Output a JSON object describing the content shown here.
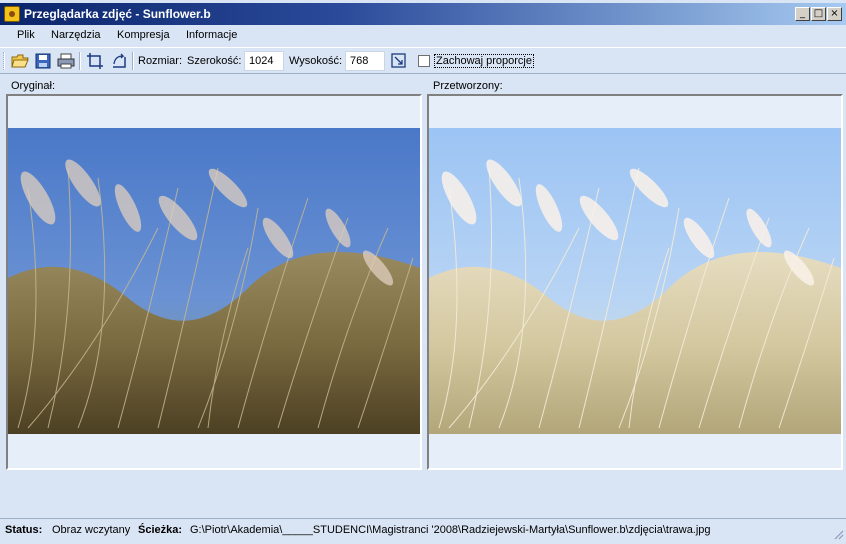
{
  "window": {
    "title": "Przeglądarka zdjęć - Sunflower.b",
    "controls": {
      "minimize": "_",
      "maximize": "□",
      "close": "×"
    }
  },
  "menu": [
    "Plik",
    "Narzędzia",
    "Kompresja",
    "Informacje"
  ],
  "toolbar": {
    "buttons": [
      "open-folder-icon",
      "save-icon",
      "print-icon",
      "crop-icon",
      "rotate-icon",
      "resize-icon"
    ],
    "size_label": "Rozmiar:",
    "width_label": "Szerokość:",
    "width_value": "1024",
    "height_label": "Wysokość:",
    "height_value": "768",
    "keep_ratio_label": "Zachowaj proporcje",
    "keep_ratio_checked": false
  },
  "panels": {
    "original_label": "Oryginał:",
    "processed_label": "Przetworzony:"
  },
  "status": {
    "status_label": "Status:",
    "status_value": "Obraz wczytany",
    "path_label": "Ścieżka:",
    "path_value": "G:\\Piotr\\Akademia\\_____STUDENCI\\Magistranci '2008\\Radziejewski-Martyła\\Sunflower.b\\zdjęcia\\trawa.jpg"
  },
  "colors": {
    "title_start": "#0a246a",
    "title_end": "#a6caf0",
    "background": "#d9e4f4",
    "sky_original": "#4f7fd0",
    "sky_processed": "#9ec6f5"
  }
}
